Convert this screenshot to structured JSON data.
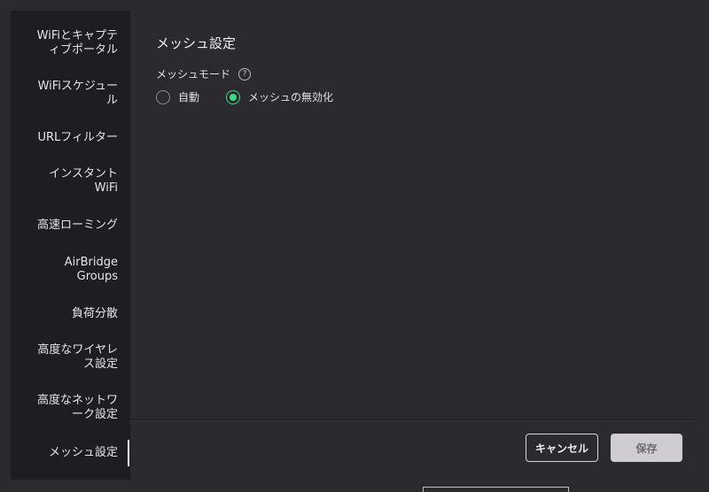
{
  "sidebar": {
    "items": [
      {
        "label": "WiFiとキャプテ\nィブポータル",
        "active": false
      },
      {
        "label": "WiFiスケジュー\nル",
        "active": false
      },
      {
        "label": "URLフィルター",
        "active": false
      },
      {
        "label": "インスタント\nWiFi",
        "active": false
      },
      {
        "label": "高速ローミング",
        "active": false
      },
      {
        "label": "AirBridge\nGroups",
        "active": false
      },
      {
        "label": "負荷分散",
        "active": false
      },
      {
        "label": "高度なワイヤレ\nス設定",
        "active": false
      },
      {
        "label": "高度なネットワ\nーク設定",
        "active": false
      },
      {
        "label": "メッシュ設定",
        "active": true
      }
    ]
  },
  "main": {
    "title": "メッシュ設定",
    "mesh_mode_label": "メッシュモード",
    "help_glyph": "?",
    "options": [
      {
        "label": "自動",
        "checked": false
      },
      {
        "label": "メッシュの無効化",
        "checked": true
      }
    ]
  },
  "footer": {
    "cancel_label": "キャンセル",
    "save_label": "保存"
  },
  "colors": {
    "accent": "#3ddc84",
    "background": "#2b2a2e",
    "sidebar": "#1e1d21"
  }
}
